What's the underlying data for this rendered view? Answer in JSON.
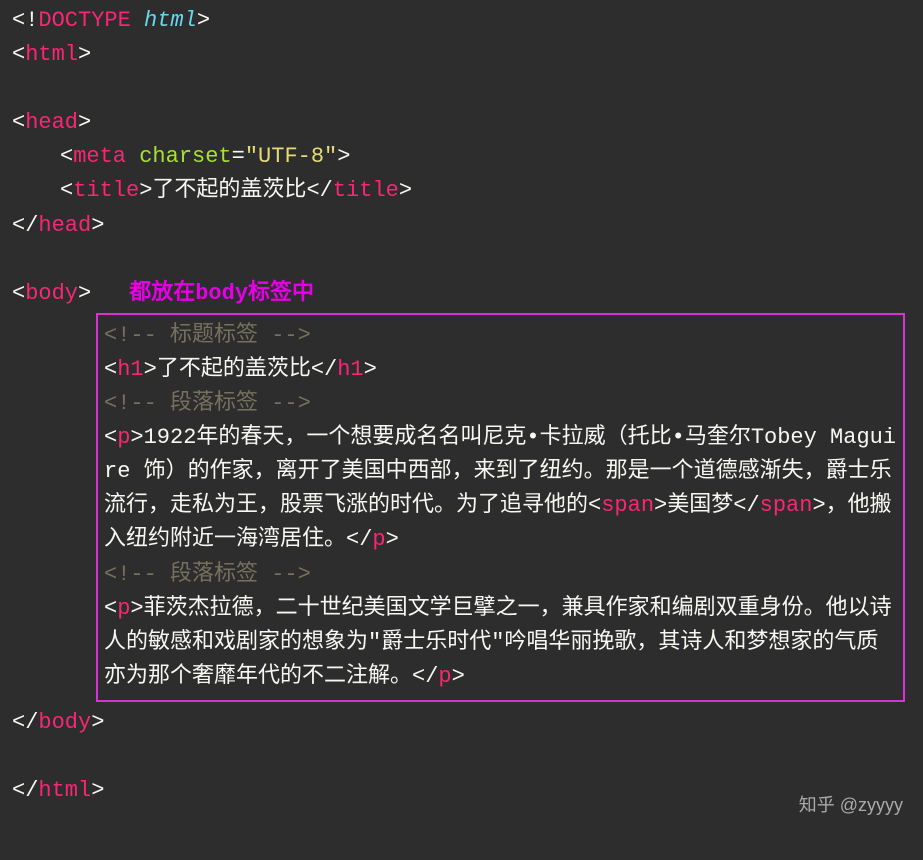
{
  "doctype": {
    "open": "<!",
    "kw": "DOCTYPE",
    "name": " html",
    "close": ">"
  },
  "html": {
    "open": "html",
    "close": "html"
  },
  "head": {
    "open": "head",
    "close": "head"
  },
  "meta": {
    "tag": "meta",
    "attr": "charset",
    "val": "\"UTF-8\""
  },
  "title": {
    "tag": "title",
    "text": "了不起的盖茨比"
  },
  "body": {
    "open": "body",
    "close": "body"
  },
  "annotation": "都放在body标签中",
  "comment_title": "<!-- 标题标签 -->",
  "comment_para1": "<!-- 段落标签 -->",
  "comment_para2": "<!-- 段落标签 -->",
  "h1": {
    "tag": "h1",
    "text": "了不起的盖茨比"
  },
  "p1": {
    "tag": "p",
    "before_span": "1922年的春天，一个想要成名名叫尼克•卡拉威（托比•马奎尔Tobey Maguire 饰）的作家，离开了美国中西部，来到了纽约。那是一个道德感渐失，爵士乐流行，走私为王，股票飞涨的时代。为了追寻他的",
    "span_tag": "span",
    "span_text": "美国梦",
    "after_span": "，他搬入纽约附近一海湾居住。"
  },
  "p2": {
    "tag": "p",
    "text": "菲茨杰拉德，二十世纪美国文学巨擘之一，兼具作家和编剧双重身份。他以诗人的敏感和戏剧家的想象为\"爵士乐时代\"吟唱华丽挽歌，其诗人和梦想家的气质亦为那个奢靡年代的不二注解。"
  },
  "watermark": "知乎 @zyyyy"
}
